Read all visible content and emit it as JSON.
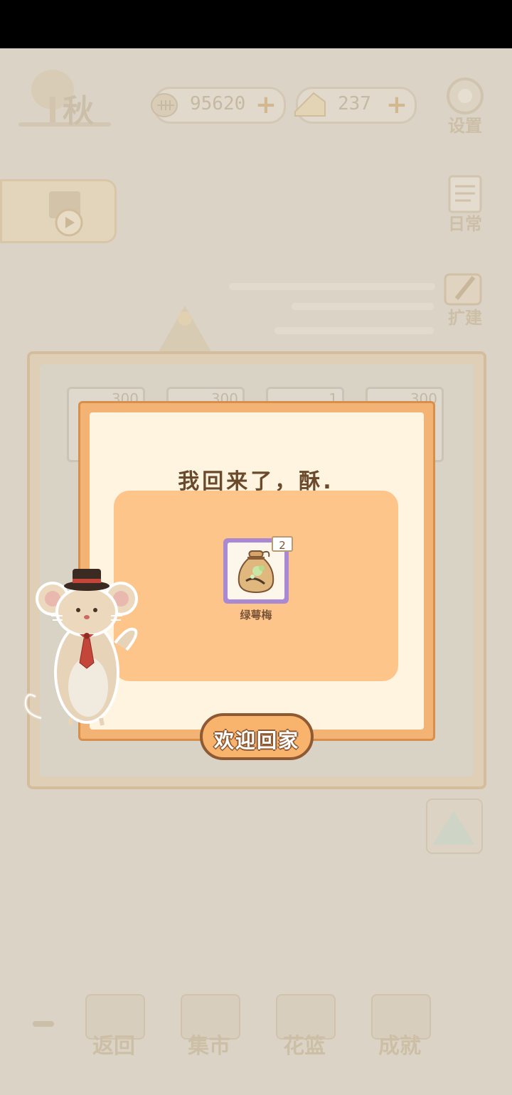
{
  "hud": {
    "season_label": "秋",
    "fish_currency": "95620",
    "cheese_currency": "237",
    "add_symbol": "+"
  },
  "side_menu": {
    "settings_label": "设置",
    "daily_label": "日常",
    "expand_label": "扩建"
  },
  "background_panel": {
    "slot_counts": [
      "300",
      "300",
      "1",
      "300"
    ]
  },
  "bottom_nav": {
    "items": [
      {
        "label": "返回"
      },
      {
        "label": "集市"
      },
      {
        "label": "花篮"
      },
      {
        "label": "成就"
      }
    ]
  },
  "dialog": {
    "title": "我回来了，酥.",
    "reward_item": {
      "name": "绿萼梅",
      "quantity": "2",
      "icon": "seed-bag-icon"
    },
    "confirm_label": "欢迎回家"
  },
  "colors": {
    "dialog_frame": "#f3b374",
    "dialog_bg": "#fff4e0",
    "reward_area": "#fec58a",
    "item_frame": "#a98ad2",
    "button_border": "#8f5a33",
    "title_text": "#6b4a2c"
  }
}
